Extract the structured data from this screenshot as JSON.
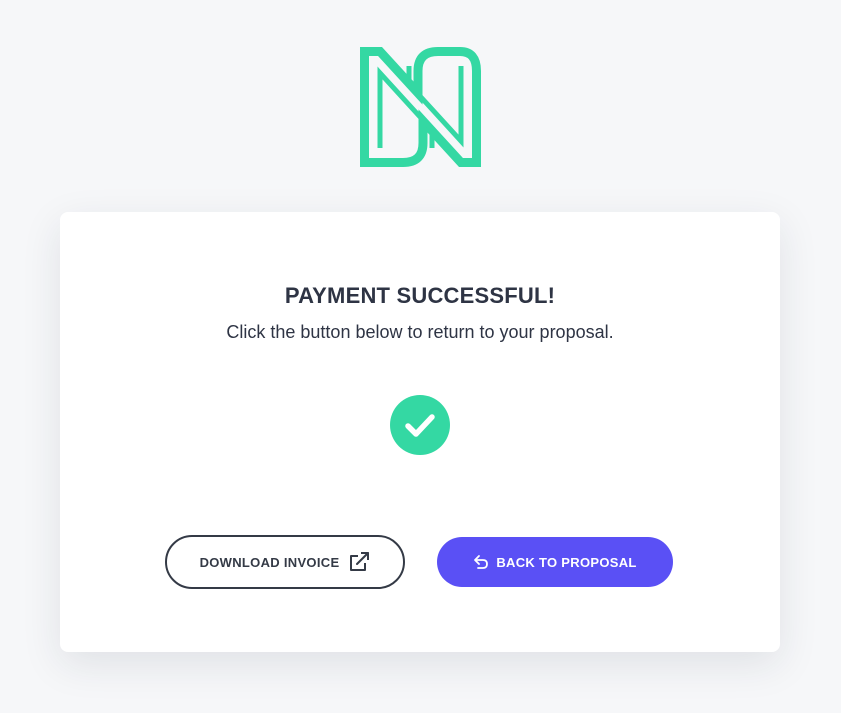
{
  "brand": {
    "logo_icon": "monogram-n-logo",
    "accent_color": "#34d8a3"
  },
  "card": {
    "title": "PAYMENT SUCCESSFUL!",
    "subtitle": "Click the button below to return to your proposal.",
    "status_icon": "checkmark-circle-icon"
  },
  "actions": {
    "download_label": "DOWNLOAD INVOICE",
    "download_icon": "external-link-icon",
    "back_label": "BACK TO PROPOSAL",
    "back_icon": "undo-arrow-icon",
    "back_color": "#5a50f5"
  }
}
